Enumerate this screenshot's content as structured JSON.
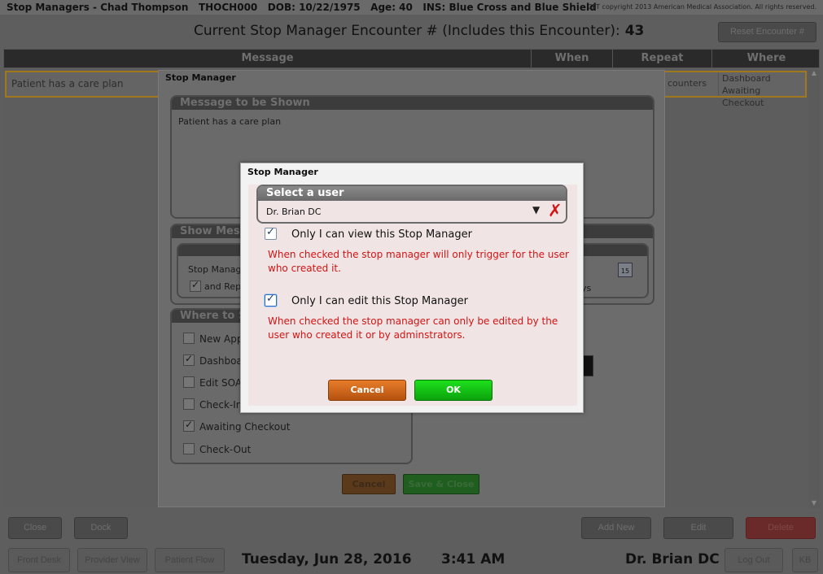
{
  "titlebar": {
    "text": "Stop Managers - Chad Thompson   THOCH000   DOB: 10/22/1975   Age: 40   INS: Blue Cross and Blue Shield",
    "copyright": "CPT copyright 2013 American Medical Association. All rights reserved."
  },
  "encounter": {
    "label": "Current Stop Manager Encounter # (Includes this Encounter):",
    "count": "43",
    "reset_label": "Reset Encounter #"
  },
  "table": {
    "headers": [
      "Message",
      "When",
      "Repeat",
      "Where"
    ],
    "row": {
      "message": "Patient has a care plan",
      "repeat": "counters",
      "where": [
        "Dashboard",
        "Awaiting Checkout"
      ]
    }
  },
  "bottom": {
    "close": "Close",
    "dock": "Dock",
    "add_new": "Add New",
    "edit": "Edit",
    "delete": "Delete"
  },
  "footer": {
    "front_desk": "Front Desk",
    "provider_view": "Provider View",
    "patient_flow": "Patient Flow",
    "date": "Tuesday, Jun 28, 2016",
    "time": "3:41 AM",
    "user": "Dr. Brian DC",
    "logout": "Log Out",
    "kb": "KB"
  },
  "outer_modal": {
    "title": "Stop Manager",
    "message_panel": {
      "title": "Message to be Shown",
      "text": "Patient has a care plan"
    },
    "show_panel": {
      "title": "Show Mess",
      "row1": "Stop Manag",
      "row2": "and Rep",
      "suffix": "ys"
    },
    "where_panel": {
      "title": "Where to Sh",
      "items": [
        {
          "label": "New Appo",
          "checked": false
        },
        {
          "label": "Dashboar",
          "checked": true
        },
        {
          "label": "Edit SOAP",
          "checked": false
        },
        {
          "label": "Check-In",
          "checked": false
        },
        {
          "label": "Awaiting Checkout",
          "checked": true
        },
        {
          "label": "Check-Out",
          "checked": false
        }
      ]
    },
    "cancel_label": "Cancel",
    "save_label": "Save & Close"
  },
  "dialog": {
    "title": "Stop Manager",
    "select_user": {
      "title": "Select a user",
      "value": "Dr. Brian DC"
    },
    "option_view": {
      "label": "Only I can view this Stop Manager",
      "checked": true,
      "note": "When checked the stop manager will only trigger for the user who created it."
    },
    "option_edit": {
      "label": "Only I can edit this Stop Manager",
      "checked": true,
      "note": "When checked the stop manager can only be edited by the user who created it or by adminstrators."
    },
    "cancel_label": "Cancel",
    "ok_label": "OK"
  }
}
